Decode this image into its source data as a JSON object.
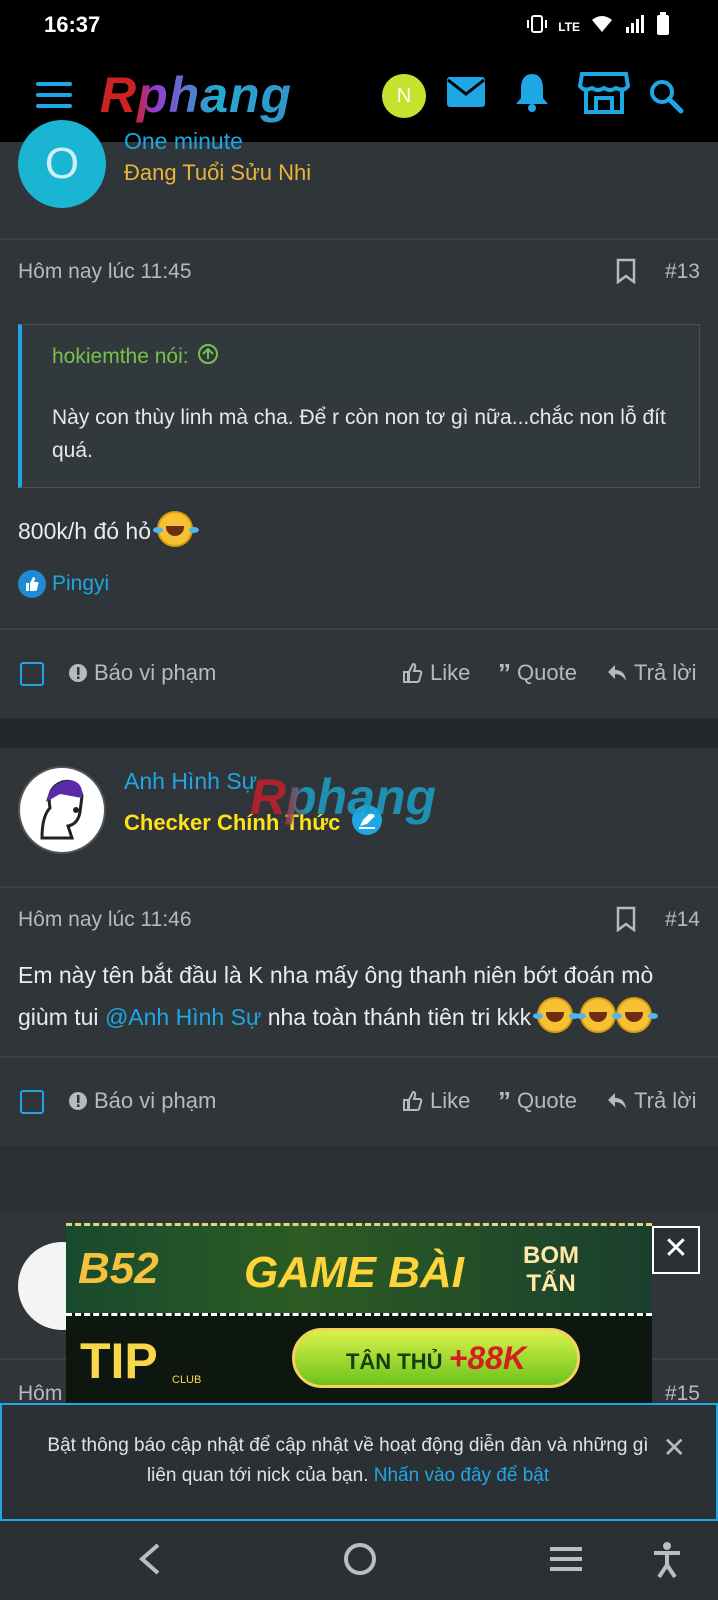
{
  "status_bar": {
    "time": "16:37",
    "network": "LTE"
  },
  "header": {
    "logo": "Rphang",
    "avatar_letter": "N"
  },
  "colors": {
    "accent": "#1ea7e4",
    "avatar_o": "#1bb5d4",
    "avatar_n": "#c6e22f",
    "rank_yellow": "#ffe11a",
    "rank_orange": "#e8b43a",
    "quote_green": "#77c24a"
  },
  "posts": [
    {
      "author_name": "One minute",
      "author_title": "Đang Tuổi Sửu Nhi",
      "avatar_letter": "O",
      "date": "Hôm nay lúc 11:45",
      "number": "#13",
      "quote": {
        "author": "hokiemthe nói:",
        "text": "Này con thùy linh mà cha. Để r còn non tơ gì nữa...chắc non lỗ đít quá."
      },
      "body": "800k/h đó hỏ",
      "reaction_user": "Pingyi",
      "actions": {
        "report": "Báo vi phạm",
        "like": "Like",
        "quote": "Quote",
        "reply": "Trả lời"
      }
    },
    {
      "author_name": "Anh Hình Sự",
      "author_title": "Checker Chính Thức",
      "date": "Hôm nay lúc 11:46",
      "number": "#14",
      "body_prefix": "Em này tên bắt đầu là K nha mấy ông thanh niên bớt đoán mò giùm tui ",
      "mention": "@Anh Hình Sự",
      "body_suffix": " nha toàn thánh tiên tri kkk",
      "actions": {
        "report": "Báo vi phạm",
        "like": "Like",
        "quote": "Quote",
        "reply": "Trả lời"
      }
    },
    {
      "date": "Hôm",
      "number": "#15"
    }
  ],
  "ad": {
    "brand": "B52",
    "headline": "GAME BÀI",
    "tag": "BOM TẤN",
    "brand2": "TIP",
    "brand2_sub": "CLUB",
    "cta": "TÂN THỦ",
    "cta_bonus": "+88K"
  },
  "notification": {
    "message": "Bật thông báo cập nhật để cập nhật về hoạt động diễn đàn và những gì liên quan tới nick của bạn. ",
    "link": "Nhấn vào đây để bật"
  }
}
